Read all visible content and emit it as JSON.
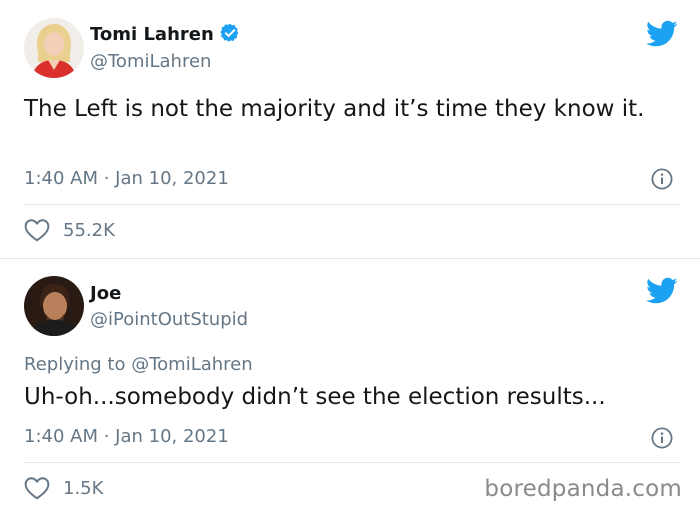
{
  "colors": {
    "twitter_blue": "#1da1f2",
    "text_primary": "#14171a",
    "text_secondary": "#657786",
    "divider": "#e1e8ed"
  },
  "tweets": [
    {
      "display_name": "Tomi Lahren",
      "handle": "@TomiLahren",
      "verified": true,
      "text": "The Left is not the majority and it’s time they know it.",
      "timestamp": "1:40 AM · Jan 10, 2021",
      "likes": "55.2K",
      "icons": [
        "avatar",
        "verified-badge-icon",
        "twitter-bird-icon",
        "info-icon",
        "heart-icon"
      ]
    },
    {
      "display_name": "Joe",
      "handle": "@iPointOutStupid",
      "verified": false,
      "reply_prefix": "Replying to",
      "reply_handle": "@TomiLahren",
      "text": "Uh-oh...somebody didn’t see the election results...",
      "timestamp": "1:40 AM · Jan 10, 2021",
      "likes": "1.5K",
      "icons": [
        "avatar",
        "twitter-bird-icon",
        "info-icon",
        "heart-icon"
      ]
    }
  ],
  "watermark": "boredpanda.com"
}
